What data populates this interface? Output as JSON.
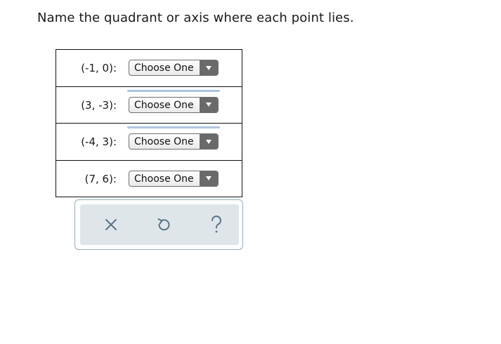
{
  "instructions": "Name the quadrant or axis where each point lies.",
  "rows": [
    {
      "point": "(-1, 0):",
      "selected": "Choose One"
    },
    {
      "point": "(3, -3):",
      "selected": "Choose One"
    },
    {
      "point": "(-4, 3):",
      "selected": "Choose One"
    },
    {
      "point": "(7, 6):",
      "selected": "Choose One"
    }
  ],
  "toolbar": {
    "icons": [
      "close-icon",
      "undo-icon",
      "help-icon"
    ],
    "icon_color": "#5a7486"
  },
  "colors": {
    "select_arrow_bg": "#6a6a6a",
    "toolbar_bg": "#dfe6ea",
    "toolbar_border": "#8fb0c0"
  }
}
